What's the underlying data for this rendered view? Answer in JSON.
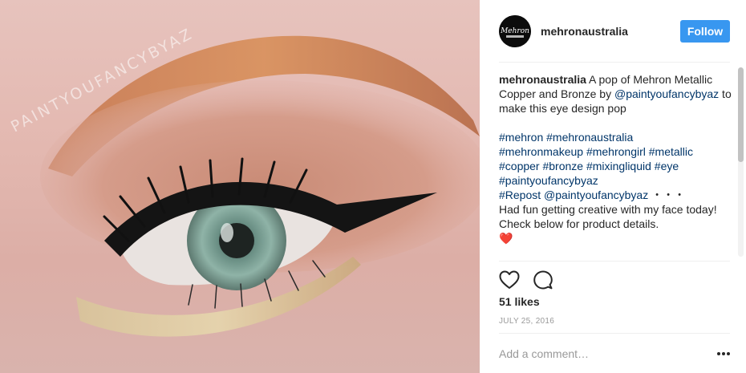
{
  "photo": {
    "alt": "Close-up eye makeup with copper and bronze metallic shadow",
    "watermark": "PAINTYOUFANCYBYAZ"
  },
  "post": {
    "avatar_text": "Mehron",
    "username": "mehronaustralia",
    "follow_label": "Follow",
    "caption": {
      "username": "mehronaustralia",
      "text_1": " A pop of Mehron Metallic Copper and Bronze by ",
      "mention_1": "@paintyoufancybyaz",
      "text_2": " to make this eye design pop",
      "hashtags_line_1": "#mehron #mehronaustralia",
      "hashtags_line_2": "#mehronmakeup #mehrongirl #metallic",
      "hashtags_line_3": "#copper #bronze #mixingliquid #eye",
      "hashtags_line_4": "#paintyoufancybyaz",
      "repost": "#Repost @paintyoufancybyaz",
      "repost_dots": " ・・・",
      "text_3": "Had fun getting creative with my face today! Check below for product details.",
      "emoji": "❤️"
    },
    "likes": "51 likes",
    "date": "JULY 25, 2016",
    "comment_placeholder": "Add a comment…"
  },
  "icons": {
    "like": "heart-icon",
    "comment": "comment-icon",
    "more": "more-options-icon"
  },
  "colors": {
    "follow_button": "#3897f0",
    "link": "#003569",
    "muted": "#999999"
  }
}
